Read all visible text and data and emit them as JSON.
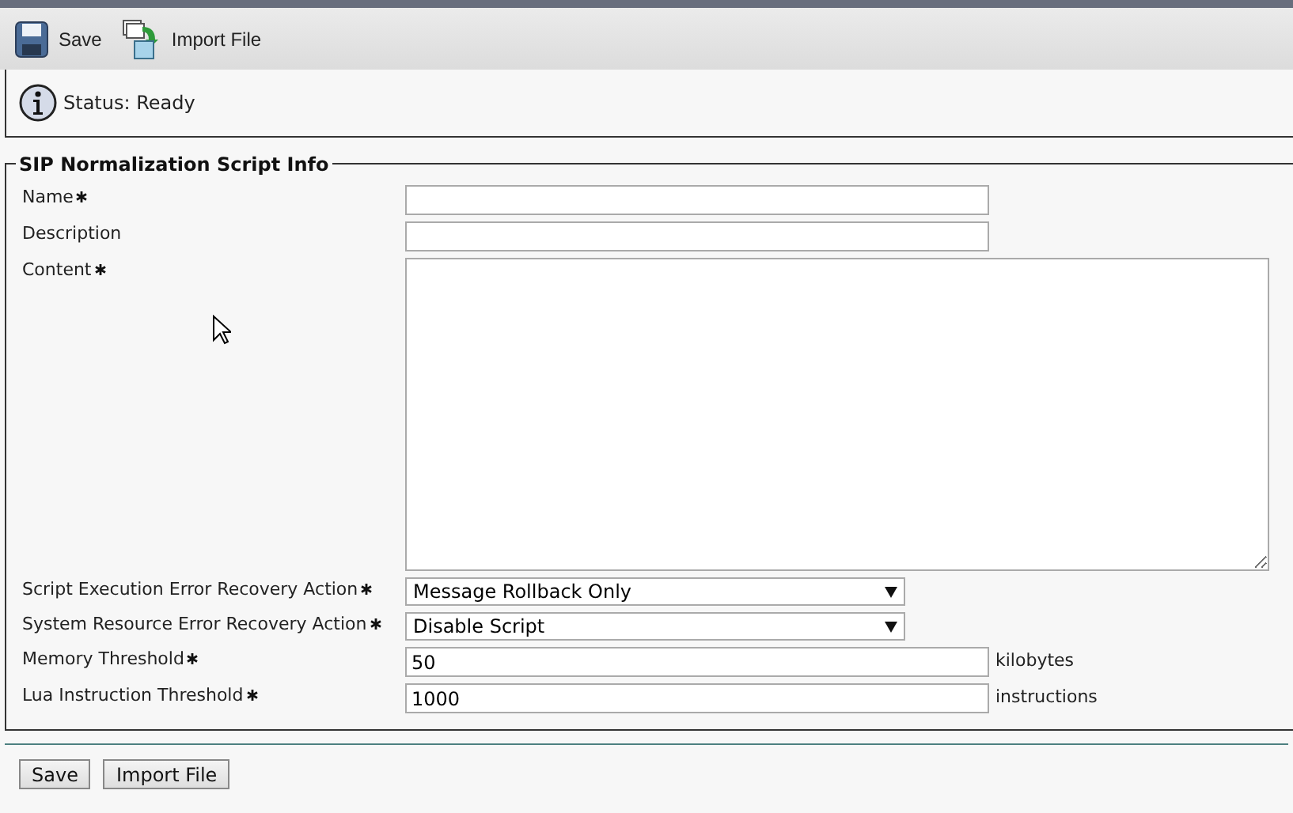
{
  "toolbar": [
    {
      "kind": "save",
      "label": "Save"
    },
    {
      "kind": "import",
      "label": "Import File"
    }
  ],
  "status": {
    "text": "Status: Ready"
  },
  "section": {
    "title": "SIP Normalization Script Info"
  },
  "fields": [
    {
      "kind": "text",
      "label": "Name",
      "required": true
    },
    {
      "kind": "text",
      "label": "Description",
      "required": false
    },
    {
      "kind": "textarea",
      "label": "Content",
      "required": true
    },
    {
      "kind": "select",
      "label": "Script Execution Error Recovery Action",
      "required": true,
      "value": "Message Rollback Only"
    },
    {
      "kind": "select",
      "label": "System Resource Error Recovery Action",
      "required": true,
      "value": "Disable Script"
    },
    {
      "kind": "text",
      "label": "Memory Threshold",
      "required": true,
      "value": "50",
      "unit": "kilobytes"
    },
    {
      "kind": "text",
      "label": "Lua Instruction Threshold",
      "required": true,
      "value": "1000",
      "unit": "instructions"
    }
  ],
  "buttons": [
    "Save",
    "Import File"
  ]
}
